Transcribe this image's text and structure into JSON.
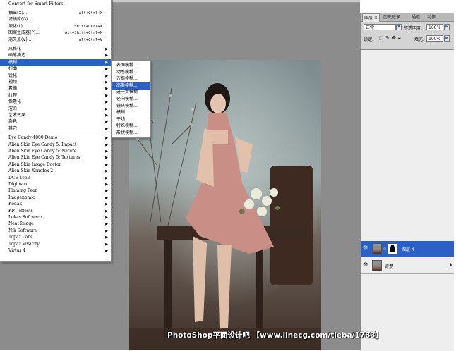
{
  "filter_menu": {
    "items": [
      {
        "label": "Convert for Smart Filters",
        "shortcut": "",
        "submenu": false,
        "style": "mono"
      },
      {
        "label": "抽出(X)...",
        "shortcut": "Alt+Ctrl+X",
        "submenu": false
      },
      {
        "label": "滤镜库(G)...",
        "shortcut": "",
        "submenu": false
      },
      {
        "label": "液化(L)...",
        "shortcut": "Shift+Ctrl+X",
        "submenu": false
      },
      {
        "label": "图案生成器(P)...",
        "shortcut": "Alt+Shift+Ctrl+X",
        "submenu": false
      },
      {
        "label": "消失点(V)...",
        "shortcut": "Alt+Ctrl+V",
        "submenu": false
      },
      {
        "label": "风格化",
        "shortcut": "",
        "submenu": true
      },
      {
        "label": "画笔描边",
        "shortcut": "",
        "submenu": true
      },
      {
        "label": "模糊",
        "shortcut": "",
        "submenu": true,
        "highlighted": true
      },
      {
        "label": "扭曲",
        "shortcut": "",
        "submenu": true
      },
      {
        "label": "锐化",
        "shortcut": "",
        "submenu": true
      },
      {
        "label": "视频",
        "shortcut": "",
        "submenu": true
      },
      {
        "label": "素描",
        "shortcut": "",
        "submenu": true
      },
      {
        "label": "纹理",
        "shortcut": "",
        "submenu": true
      },
      {
        "label": "像素化",
        "shortcut": "",
        "submenu": true
      },
      {
        "label": "渲染",
        "shortcut": "",
        "submenu": true
      },
      {
        "label": "艺术效果",
        "shortcut": "",
        "submenu": true
      },
      {
        "label": "杂色",
        "shortcut": "",
        "submenu": true
      },
      {
        "label": "其它",
        "shortcut": "",
        "submenu": true
      },
      {
        "label": "Eye Candy 4000 Demo",
        "shortcut": "",
        "submenu": true,
        "style": "mono"
      },
      {
        "label": "Alien Skin Eye Candy 5: Impact",
        "shortcut": "",
        "submenu": true,
        "style": "mono"
      },
      {
        "label": "Alien Skin Eye Candy 5: Nature",
        "shortcut": "",
        "submenu": true,
        "style": "mono"
      },
      {
        "label": "Alien Skin Eye Candy 5: Textures",
        "shortcut": "",
        "submenu": true,
        "style": "mono"
      },
      {
        "label": "Alien Skin Image Doctor",
        "shortcut": "",
        "submenu": true,
        "style": "mono"
      },
      {
        "label": "Alien Skin Xenofex 2",
        "shortcut": "",
        "submenu": true,
        "style": "mono"
      },
      {
        "label": "DCE Tools",
        "shortcut": "",
        "submenu": true,
        "style": "mono"
      },
      {
        "label": "Digimarc",
        "shortcut": "",
        "submenu": true,
        "style": "mono"
      },
      {
        "label": "Flaming Pear",
        "shortcut": "",
        "submenu": true,
        "style": "mono"
      },
      {
        "label": "Imagenomic",
        "shortcut": "",
        "submenu": true,
        "style": "mono"
      },
      {
        "label": "Kodak",
        "shortcut": "",
        "submenu": true,
        "style": "mono"
      },
      {
        "label": "KPT effects",
        "shortcut": "",
        "submenu": true,
        "style": "mono"
      },
      {
        "label": "Lokas Software",
        "shortcut": "",
        "submenu": true,
        "style": "mono"
      },
      {
        "label": "Neat Image",
        "shortcut": "",
        "submenu": true,
        "style": "mono"
      },
      {
        "label": "Nik Software",
        "shortcut": "",
        "submenu": true,
        "style": "mono"
      },
      {
        "label": "Topaz Labs",
        "shortcut": "",
        "submenu": true,
        "style": "mono"
      },
      {
        "label": "Topaz Vivacity",
        "shortcut": "",
        "submenu": true,
        "style": "mono"
      },
      {
        "label": "Virtus 4",
        "shortcut": "",
        "submenu": true,
        "style": "mono"
      }
    ]
  },
  "blur_submenu": {
    "items": [
      {
        "label": "表面模糊..."
      },
      {
        "label": "动感模糊..."
      },
      {
        "label": "方框模糊..."
      },
      {
        "label": "高斯模糊...",
        "highlighted": true
      },
      {
        "label": "进一步模糊"
      },
      {
        "label": "径向模糊..."
      },
      {
        "label": "镜头模糊..."
      },
      {
        "label": "模糊"
      },
      {
        "label": "平均"
      },
      {
        "label": "特殊模糊..."
      },
      {
        "label": "形状模糊..."
      }
    ]
  },
  "layers_panel": {
    "tabs": [
      "图层",
      "历史记录",
      "通道",
      "动作"
    ],
    "blend_mode": "正常",
    "opacity_label": "不透明度:",
    "opacity_value": "100%",
    "lock_label": "锁定:",
    "fill_label": "填充:",
    "fill_value": "100%",
    "layers": [
      {
        "name": "图层 4",
        "selected": true,
        "has_mask": true
      },
      {
        "name": "背景",
        "selected": false,
        "has_mask": false,
        "locked": true
      }
    ]
  },
  "watermark": "PhotoShop平面设计吧 【www.linecg.com/tieba/1783】",
  "colors": {
    "highlight": "#2b60c8",
    "canvas": "#8c8c8c"
  }
}
